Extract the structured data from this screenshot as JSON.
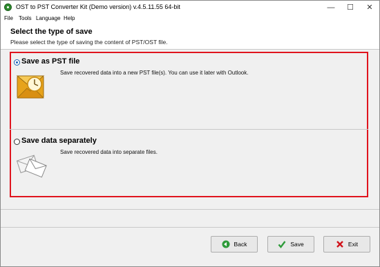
{
  "window": {
    "title": "OST to PST Converter Kit (Demo version) v.4.5.11.55 64-bit",
    "controls": {
      "minimize": "—",
      "maximize": "☐",
      "close": "✕"
    }
  },
  "menu": [
    "File",
    "Tools",
    "Language",
    "Help"
  ],
  "header": {
    "title": "Select the type of save",
    "subtitle": "Please select the type of saving the content of PST/OST file."
  },
  "options": [
    {
      "label": "Save as PST file",
      "description": "Save recovered data into a new PST file(s). You can use it later with Outlook.",
      "selected": true,
      "icon": "outlook-envelope-icon"
    },
    {
      "label": "Save data separately",
      "description": "Save recovered data into separate files.",
      "selected": false,
      "icon": "envelopes-icon"
    }
  ],
  "buttons": {
    "back": "Back",
    "save": "Save",
    "exit": "Exit"
  },
  "colors": {
    "highlight_border": "#e0141e",
    "back_icon": "#2e9b3a",
    "save_icon": "#2e9b3a",
    "exit_icon": "#d0131b"
  }
}
